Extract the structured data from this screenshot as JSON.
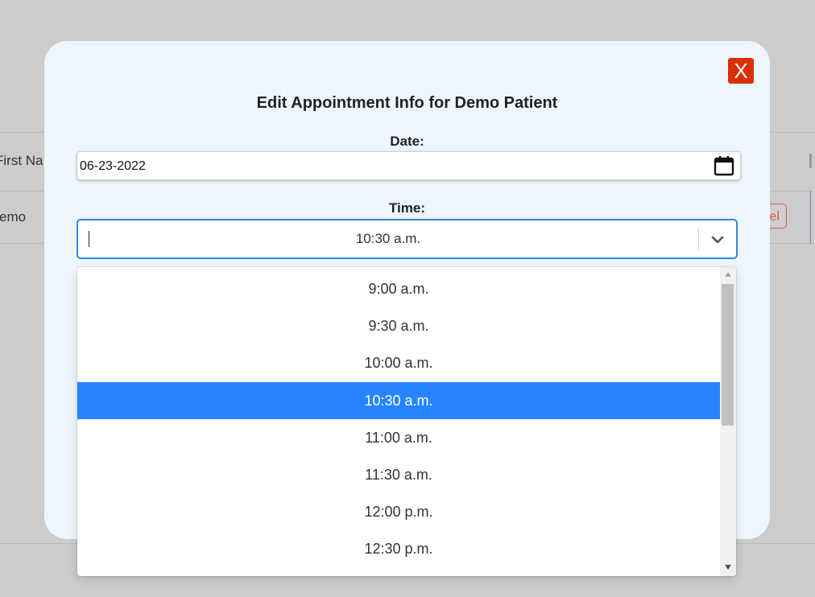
{
  "background": {
    "header_cell": "First Na",
    "row_cell": "emo",
    "row_button": "el"
  },
  "modal": {
    "close_label": "X",
    "title": "Edit Appointment Info for Demo Patient",
    "date_label": "Date:",
    "date_value": "06-23-2022",
    "time_label": "Time:",
    "time_value": "10:30 a.m.",
    "icons": {
      "calendar": "calendar-icon",
      "chevron": "chevron-down-icon"
    },
    "colors": {
      "close": "#d9300a",
      "focus": "#2e86e6",
      "selected": "#2684ff",
      "modal_bg": "#eef6fd"
    }
  },
  "time_options": {
    "selected_index": 3,
    "items": [
      "9:00 a.m.",
      "9:30 a.m.",
      "10:00 a.m.",
      "10:30 a.m.",
      "11:00 a.m.",
      "11:30 a.m.",
      "12:00 p.m.",
      "12:30 p.m."
    ]
  }
}
